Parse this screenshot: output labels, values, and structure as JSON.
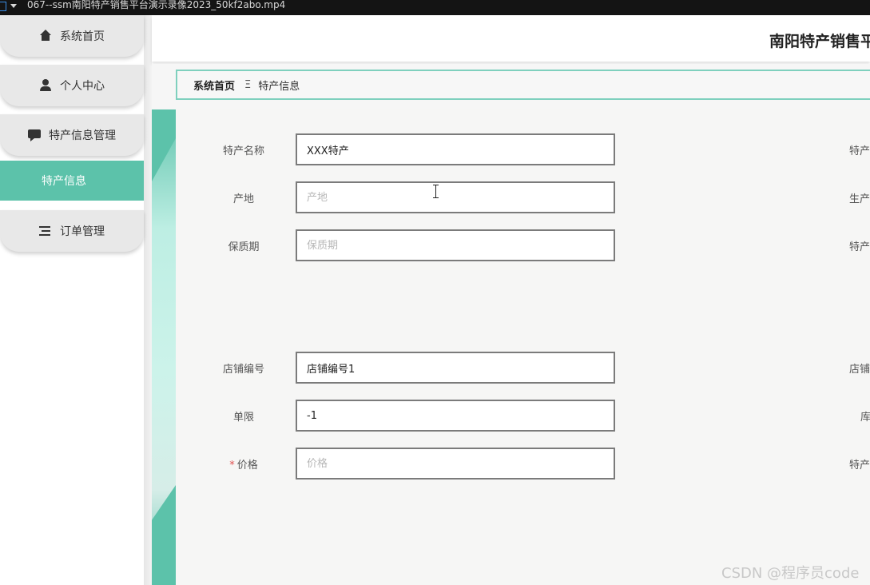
{
  "window": {
    "title": "067--ssm南阳特产销售平台演示录像2023_50kf2abo.mp4"
  },
  "sidebar": {
    "items": [
      {
        "label": "系统首页",
        "icon": "home-icon"
      },
      {
        "label": "个人中心",
        "icon": "user-icon"
      },
      {
        "label": "特产信息管理",
        "icon": "chat-icon"
      },
      {
        "label": "特产信息",
        "icon": ""
      },
      {
        "label": "订单管理",
        "icon": "list-icon"
      }
    ]
  },
  "header": {
    "title": "南阳特产销售平"
  },
  "breadcrumb": {
    "home": "系统首页",
    "separator": "Ξ",
    "current": "特产信息"
  },
  "form": {
    "fields": [
      {
        "label": "特产名称",
        "value": "XXX特产",
        "placeholder": ""
      },
      {
        "label": "产地",
        "value": "",
        "placeholder": "产地"
      },
      {
        "label": "保质期",
        "value": "",
        "placeholder": "保质期"
      },
      {
        "label": "店铺编号",
        "value": "店铺编号1",
        "placeholder": ""
      },
      {
        "label": "单限",
        "value": "-1",
        "placeholder": ""
      },
      {
        "label": "价格",
        "value": "",
        "placeholder": "价格",
        "required_mark": "*"
      }
    ],
    "right_labels": [
      "特产",
      "生产",
      "特产",
      "店铺",
      "库",
      "特产"
    ]
  },
  "watermark": "CSDN @程序员code",
  "colors": {
    "accent": "#5cc2aa",
    "border": "#7fd0be",
    "required": "#e05050"
  }
}
